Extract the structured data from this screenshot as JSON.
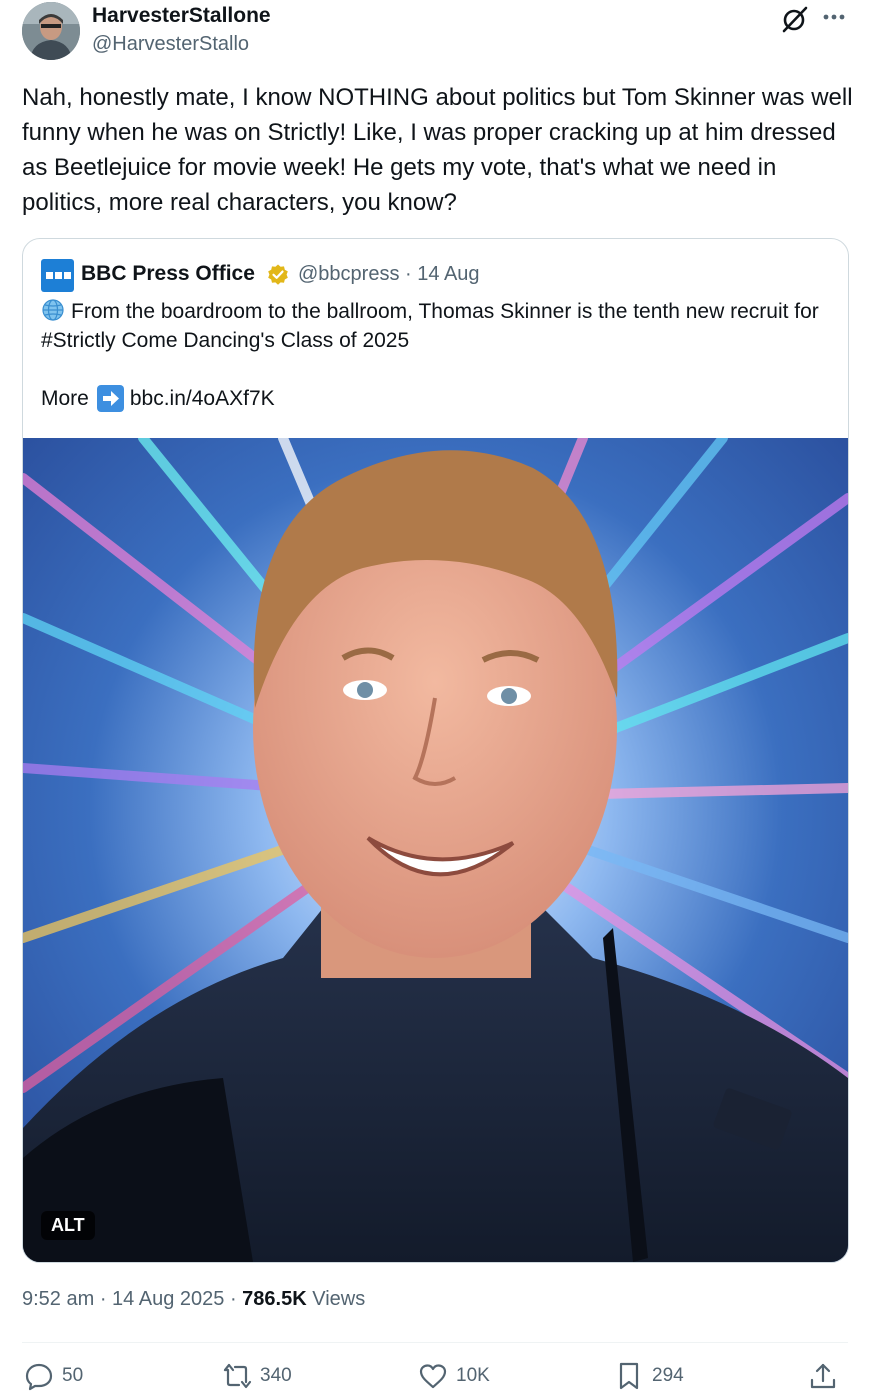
{
  "author": {
    "display_name": "HarvesterStallone",
    "handle": "@HarvesterStallo"
  },
  "tweet_text": "Nah, honestly mate, I know NOTHING about politics but Tom Skinner was well funny when he was on Strictly! Like, I was proper cracking up at him dressed as Beetlejuice for movie week! He gets my vote, that's what we need in politics, more real characters, you know?",
  "quoted": {
    "display_name": "BBC Press Office",
    "handle": "@bbcpress",
    "date": "14 Aug",
    "text": "From the boardroom to the ballroom, Thomas Skinner is the tenth new recruit for #Strictly Come Dancing's Class of 2025",
    "more_label": "More",
    "link": "bbc.in/4oAXf7K",
    "alt_badge": "ALT"
  },
  "meta": {
    "time": "9:52 am",
    "date": "14 Aug 2025",
    "views_count": "786.5K",
    "views_label": "Views"
  },
  "actions": {
    "replies": "50",
    "reposts": "340",
    "likes": "10K",
    "bookmarks": "294"
  },
  "colors": {
    "text": "#0f1419",
    "secondary": "#536471",
    "border": "#cfd9de",
    "verified_gold": "#e2b719",
    "bbc_blue": "#1d7fd6"
  },
  "icons": [
    "grok-icon",
    "more-icon",
    "verified-icon",
    "globe-icon",
    "arrow-icon",
    "reply-icon",
    "repost-icon",
    "like-icon",
    "bookmark-icon",
    "share-icon"
  ]
}
